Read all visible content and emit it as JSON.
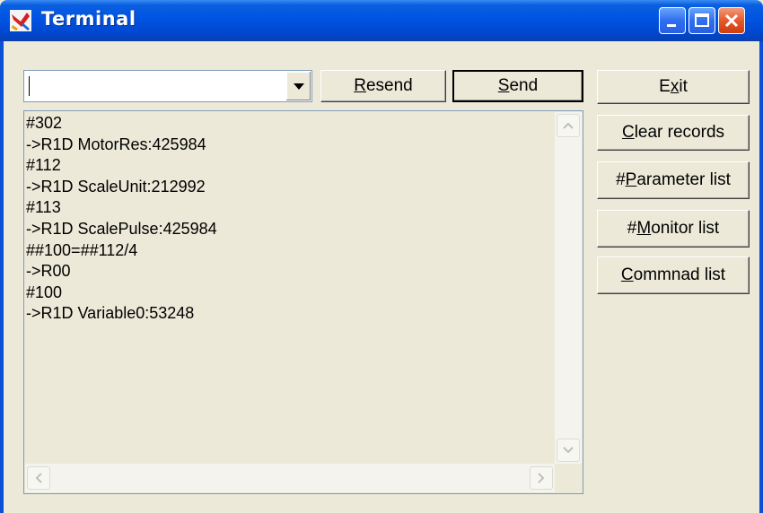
{
  "window": {
    "title": "Terminal"
  },
  "command": {
    "value": ""
  },
  "buttons": {
    "resend": {
      "pre": "",
      "key": "R",
      "post": "esend"
    },
    "send": {
      "pre": "",
      "key": "S",
      "post": "end"
    },
    "exit": {
      "pre": "E",
      "key": "x",
      "post": "it"
    },
    "clear": {
      "pre": "",
      "key": "C",
      "post": "lear records"
    },
    "param": {
      "pre": "#",
      "key": "P",
      "post": "arameter list"
    },
    "monitor": {
      "pre": "#",
      "key": "M",
      "post": "onitor list"
    },
    "commands": {
      "pre": "",
      "key": "C",
      "post": "ommnad list"
    }
  },
  "log": {
    "lines": [
      "#302",
      "->R1D MotorRes:425984",
      "#112",
      "->R1D ScaleUnit:212992",
      "#113",
      "->R1D ScalePulse:425984",
      "##100=##112/4",
      "->R00",
      "#100",
      "->R1D Variable0:53248"
    ]
  },
  "colors": {
    "titlebar": "#0054e3",
    "close_button": "#e5582a",
    "window_body": "#ece9d8"
  },
  "icons": {
    "app": "terminal-app-icon",
    "minimize": "minimize-icon",
    "maximize": "maximize-icon",
    "close": "close-icon"
  }
}
